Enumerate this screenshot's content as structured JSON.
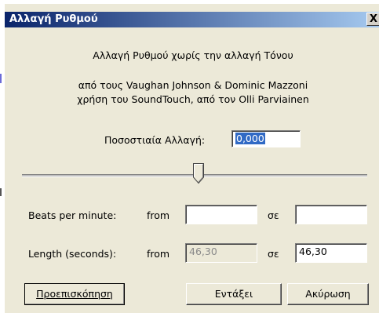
{
  "dialog": {
    "title": "Αλλαγή Ρυθμού",
    "close_label": "X"
  },
  "header": {
    "line1": "Αλλαγή Ρυθμού χωρίς την αλλαγή Τόνου",
    "line2": "από τους Vaughan Johnson & Dominic Mazzoni",
    "line3": "χρήση του SoundTouch, από τον Olli Parviainen"
  },
  "percent_change": {
    "label": "Ποσοστιαία Αλλαγή:",
    "value": "0,000"
  },
  "slider": {
    "value": 0
  },
  "bpm": {
    "label": "Beats per minute:",
    "from_label": "from",
    "from_value": "",
    "to_label": "σε",
    "to_value": ""
  },
  "length": {
    "label": "Length (seconds):",
    "from_label": "from",
    "from_value": "46,30",
    "to_label": "σε",
    "to_value": "46,30"
  },
  "buttons": {
    "preview": "Προεπισκόπηση",
    "ok": "Εντάξει",
    "cancel": "Ακύρωση"
  }
}
